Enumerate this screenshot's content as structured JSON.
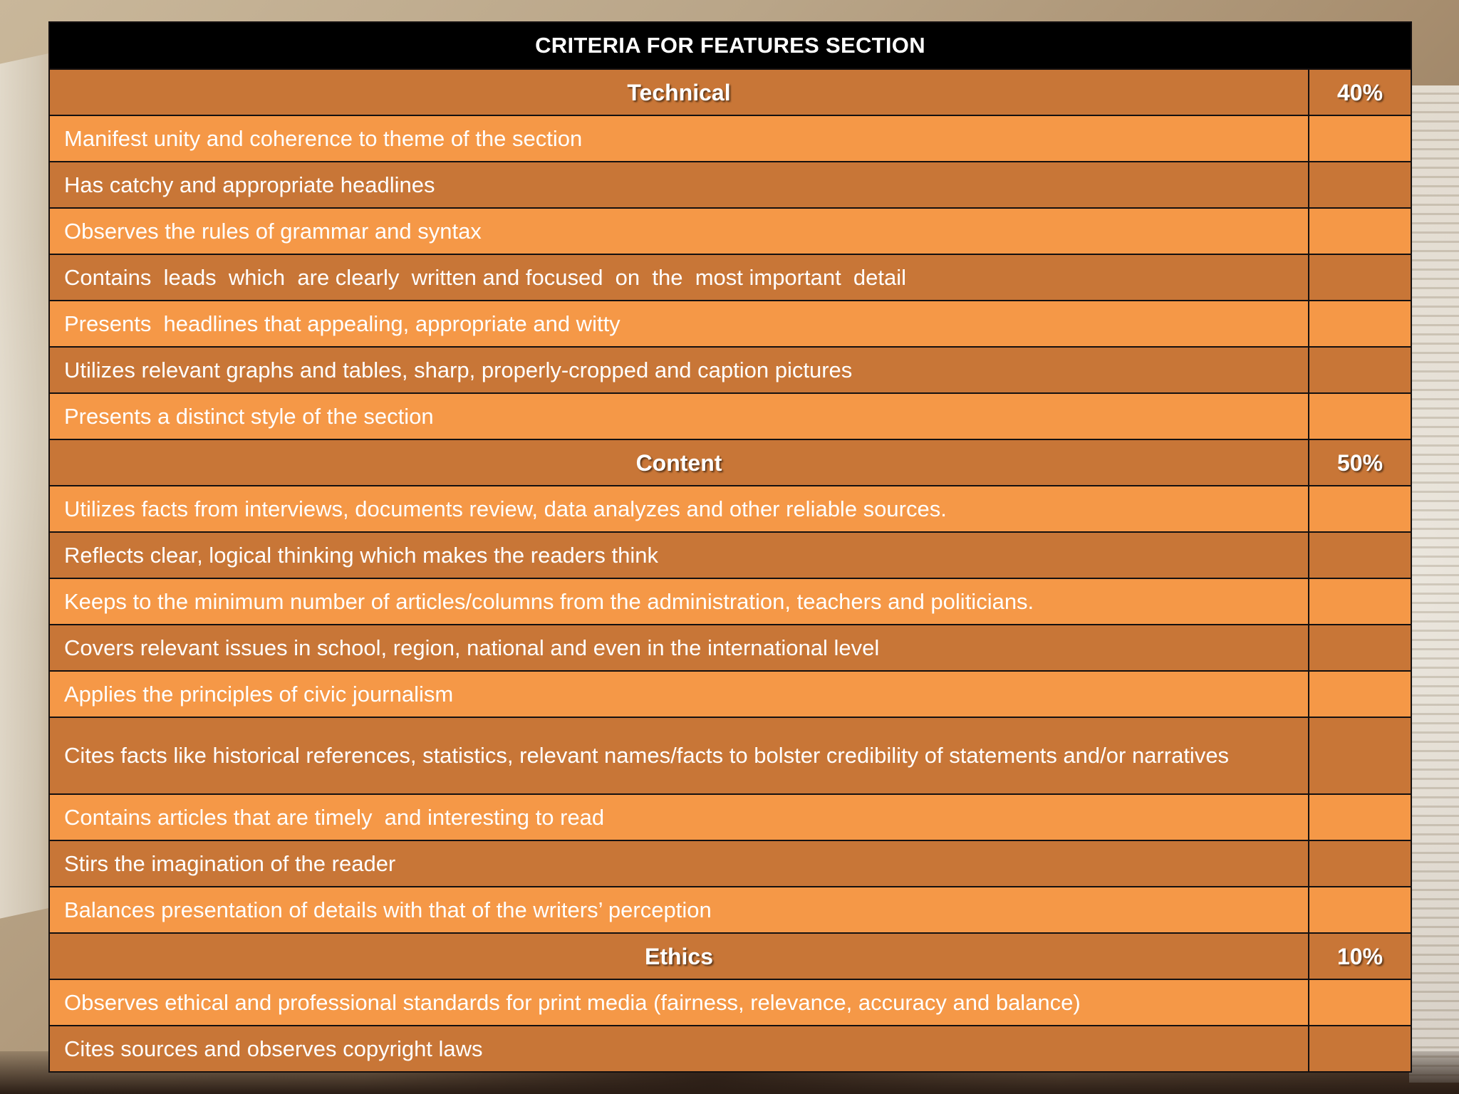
{
  "title": "CRITERIA FOR FEATURES SECTION",
  "categories": [
    {
      "name": "Technical",
      "percent": "40%",
      "items": [
        "Manifest unity and coherence to theme of the section",
        "Has catchy and appropriate headlines",
        "Observes the rules of grammar and syntax",
        "Contains  leads  which  are clearly  written and focused  on  the  most important  detail",
        "Presents  headlines that appealing, appropriate and witty",
        "Utilizes relevant graphs and tables, sharp, properly-cropped and caption pictures",
        "Presents a distinct style of the section"
      ]
    },
    {
      "name": "Content",
      "percent": "50%",
      "items": [
        "Utilizes facts from interviews, documents review, data analyzes and other reliable sources.",
        "Reflects clear, logical thinking which makes the readers think",
        "Keeps to the minimum number of articles/columns from the administration, teachers and politicians.",
        "Covers relevant issues in school, region, national and even in the international level",
        "Applies the principles of civic journalism",
        "Cites facts like historical references, statistics, relevant names/facts to bolster credibility of statements and/or narratives",
        "Contains articles that are timely  and interesting to read",
        "Stirs the imagination of the reader",
        "Balances presentation of details with that of the writers’ perception"
      ]
    },
    {
      "name": "Ethics",
      "percent": "10%",
      "items": [
        "Observes ethical and professional standards for print media (fairness, relevance, accuracy and balance)",
        "Cites sources and observes copyright laws"
      ]
    }
  ],
  "colors": {
    "header_bg": "#000000",
    "category_bg": "#c87637",
    "row_light": "#f59847",
    "row_dark": "#c87637",
    "border": "#141010",
    "text": "#ffffff"
  }
}
